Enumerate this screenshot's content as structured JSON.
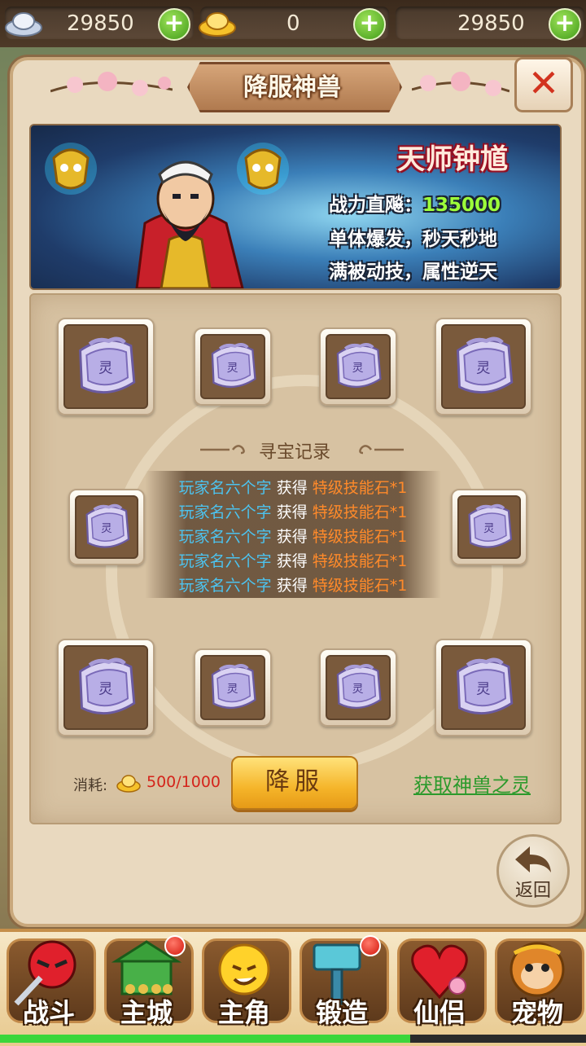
{
  "currency": {
    "silver": "29850",
    "gold": "0",
    "third": "29850",
    "plus": "+"
  },
  "panel": {
    "title": "降服神兽",
    "close": "✕"
  },
  "banner": {
    "name": "天师钟馗",
    "power_label": "战力直飚：",
    "power_value": "135000",
    "line2": "单体爆发，秒天秒地",
    "line3": "满被动技，属性逆天"
  },
  "slot_item": {
    "icon": "spirit-tablet-icon",
    "glyph": "灵"
  },
  "record": {
    "title": "寻宝记录",
    "entries": [
      {
        "player": "玩家名六个字",
        "verb": "获得",
        "item": "特级技能石*1"
      },
      {
        "player": "玩家名六个字",
        "verb": "获得",
        "item": "特级技能石*1"
      },
      {
        "player": "玩家名六个字",
        "verb": "获得",
        "item": "特级技能石*1"
      },
      {
        "player": "玩家名六个字",
        "verb": "获得",
        "item": "特级技能石*1"
      },
      {
        "player": "玩家名六个字",
        "verb": "获得",
        "item": "特级技能石*1"
      }
    ]
  },
  "actions": {
    "cost_label": "消耗:",
    "cost_value": "500/1000",
    "tame_button": "降服",
    "get_link": "获取神兽之灵",
    "back": "返回"
  },
  "nav": [
    {
      "label": "战斗",
      "icon": "ninja-icon"
    },
    {
      "label": "主城",
      "icon": "city-gate-icon"
    },
    {
      "label": "主角",
      "icon": "hero-face-icon"
    },
    {
      "label": "锻造",
      "icon": "hammer-icon"
    },
    {
      "label": "仙侣",
      "icon": "heart-flower-icon"
    },
    {
      "label": "宠物",
      "icon": "monkey-icon"
    }
  ],
  "colors": {
    "player_name": "#4cc3ef",
    "item_name": "#ff8a2a",
    "cost": "#d4241b",
    "link": "#2c9a2c",
    "notify": "#d4160c"
  },
  "progress": 0.7
}
